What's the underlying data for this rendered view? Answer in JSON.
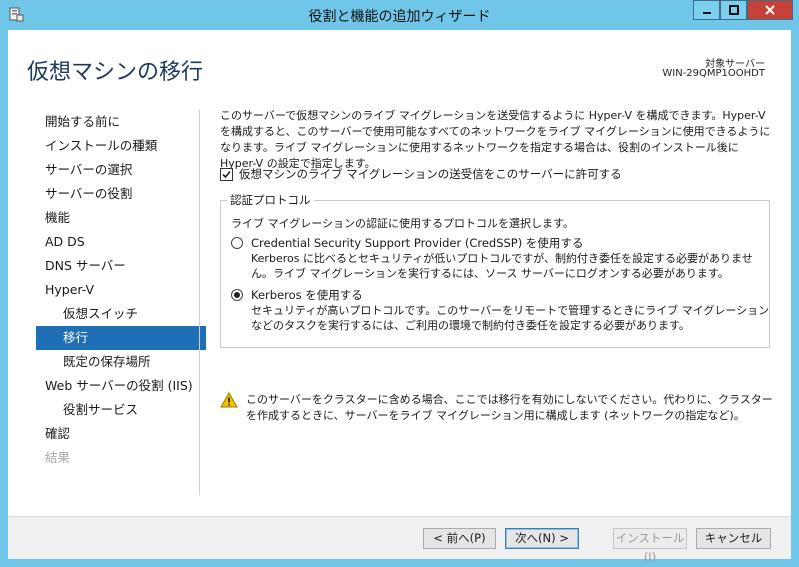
{
  "window": {
    "title": "役割と機能の追加ウィザード",
    "controls": {
      "minimize": "–",
      "maximize": "□",
      "close": "✕"
    }
  },
  "header": {
    "page_title": "仮想マシンの移行",
    "target_server_label": "対象サーバー",
    "target_server_name": "WIN-29QMP1OOHDT"
  },
  "nav": {
    "items": [
      {
        "label": "開始する前に"
      },
      {
        "label": "インストールの種類"
      },
      {
        "label": "サーバーの選択"
      },
      {
        "label": "サーバーの役割"
      },
      {
        "label": "機能"
      },
      {
        "label": "AD DS"
      },
      {
        "label": "DNS サーバー"
      },
      {
        "label": "Hyper-V"
      },
      {
        "label": "仮想スイッチ"
      },
      {
        "label": "移行"
      },
      {
        "label": "既定の保存場所"
      },
      {
        "label": "Web サーバーの役割 (IIS)"
      },
      {
        "label": "役割サービス"
      },
      {
        "label": "確認"
      },
      {
        "label": "結果"
      }
    ]
  },
  "main": {
    "description": "このサーバーで仮想マシンのライブ マイグレーションを送受信するように Hyper-V を構成できます。Hyper-V を構成すると、このサーバーで使用可能なすべてのネットワークをライブ マイグレーションに使用できるようになります。ライブ マイグレーションに使用するネットワークを指定する場合は、役割のインストール後に Hyper-V の設定で指定します。",
    "allow_migration_label": "仮想マシンのライブ マイグレーションの送受信をこのサーバーに許可する",
    "allow_migration_checked": true,
    "auth_group": {
      "legend": "認証プロトコル",
      "description": "ライブ マイグレーションの認証に使用するプロトコルを選択します。",
      "options": [
        {
          "label": "Credential Security Support Provider (CredSSP) を使用する",
          "detail": "Kerberos に比べるとセキュリティが低いプロトコルですが、制約付き委任を設定する必要がありません。ライブ マイグレーションを実行するには、ソース サーバーにログオンする必要があります。",
          "selected": false
        },
        {
          "label": "Kerberos を使用する",
          "detail": "セキュリティが高いプロトコルです。このサーバーをリモートで管理するときにライブ マイグレーションなどのタスクを実行するには、ご利用の環境で制約付き委任を設定する必要があります。",
          "selected": true
        }
      ]
    },
    "warning": "このサーバーをクラスターに含める場合、ここでは移行を有効にしないでください。代わりに、クラスターを作成するときに、サーバーをライブ マイグレーション用に構成します (ネットワークの指定など)。"
  },
  "footer": {
    "prev": "< 前へ(P)",
    "next": "次へ(N) >",
    "install": "インストール(I)",
    "cancel": "キャンセル"
  },
  "colors": {
    "frame": "#6fc6e8",
    "nav_active": "#1f6fb6",
    "title": "#1e395b",
    "close_button": "#c7403a"
  }
}
